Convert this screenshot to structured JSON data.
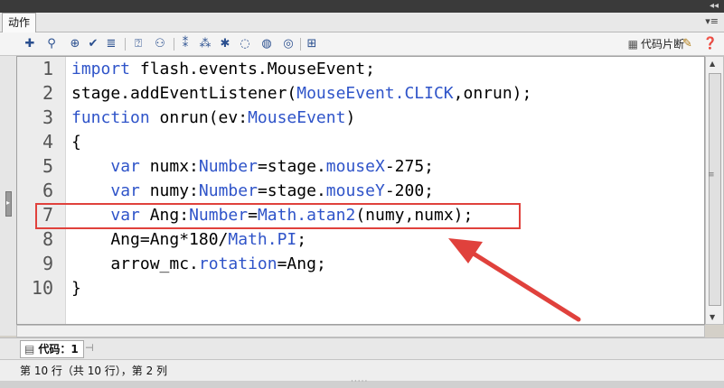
{
  "panel": {
    "tab_label": "动作",
    "collapse_glyph": "◂◂",
    "menu_glyph": "▾≡"
  },
  "toolbar": {
    "icons": [
      "add-statement-icon",
      "find-icon",
      "target-icon",
      "check-syntax-icon",
      "auto-format-icon",
      "code-hint-icon",
      "debug-options-icon",
      "collapse-braces-icon",
      "collapse-selection-icon",
      "expand-all-icon",
      "apply-block-comment-icon",
      "apply-line-comment-icon",
      "remove-comment-icon",
      "show-hide-toolbox-icon"
    ],
    "code_snippets_label": "代码片断"
  },
  "editor": {
    "line_numbers": [
      "1",
      "2",
      "3",
      "4",
      "5",
      "6",
      "7",
      "8",
      "9",
      "10"
    ],
    "lines": [
      [
        {
          "t": "import",
          "c": "kw"
        },
        {
          "t": " flash.events.MouseEvent;",
          "c": ""
        }
      ],
      [
        {
          "t": "stage.addEventListener(",
          "c": ""
        },
        {
          "t": "MouseEvent.CLICK",
          "c": "tp"
        },
        {
          "t": ",onrun);",
          "c": ""
        }
      ],
      [
        {
          "t": "function",
          "c": "kw"
        },
        {
          "t": " onrun(ev:",
          "c": ""
        },
        {
          "t": "MouseEvent",
          "c": "tp"
        },
        {
          "t": ")",
          "c": ""
        }
      ],
      [
        {
          "t": "{",
          "c": ""
        }
      ],
      [
        {
          "t": "    ",
          "c": ""
        },
        {
          "t": "var",
          "c": "kw"
        },
        {
          "t": " numx:",
          "c": ""
        },
        {
          "t": "Number",
          "c": "tp"
        },
        {
          "t": "=stage.",
          "c": ""
        },
        {
          "t": "mouseX",
          "c": "tp"
        },
        {
          "t": "-275;",
          "c": ""
        }
      ],
      [
        {
          "t": "    ",
          "c": ""
        },
        {
          "t": "var",
          "c": "kw"
        },
        {
          "t": " numy:",
          "c": ""
        },
        {
          "t": "Number",
          "c": "tp"
        },
        {
          "t": "=stage.",
          "c": ""
        },
        {
          "t": "mouseY",
          "c": "tp"
        },
        {
          "t": "-200;",
          "c": ""
        }
      ],
      [
        {
          "t": "    ",
          "c": ""
        },
        {
          "t": "var",
          "c": "kw"
        },
        {
          "t": " Ang:",
          "c": ""
        },
        {
          "t": "Number",
          "c": "tp"
        },
        {
          "t": "=",
          "c": ""
        },
        {
          "t": "Math.atan2",
          "c": "tp"
        },
        {
          "t": "(numy,numx);",
          "c": ""
        }
      ],
      [
        {
          "t": "    Ang=Ang*180/",
          "c": ""
        },
        {
          "t": "Math.PI",
          "c": "tp"
        },
        {
          "t": ";",
          "c": ""
        }
      ],
      [
        {
          "t": "    arrow_mc.",
          "c": ""
        },
        {
          "t": "rotation",
          "c": "tp"
        },
        {
          "t": "=Ang;",
          "c": ""
        }
      ],
      [
        {
          "t": "}",
          "c": ""
        }
      ]
    ],
    "highlighted_line": 7,
    "annotation_color": "#e0413c",
    "keyword_color": "#2f54c9"
  },
  "doc_tab": {
    "label": "代码：1"
  },
  "status": {
    "text": "第 10 行（共 10 行），第 2 列"
  }
}
